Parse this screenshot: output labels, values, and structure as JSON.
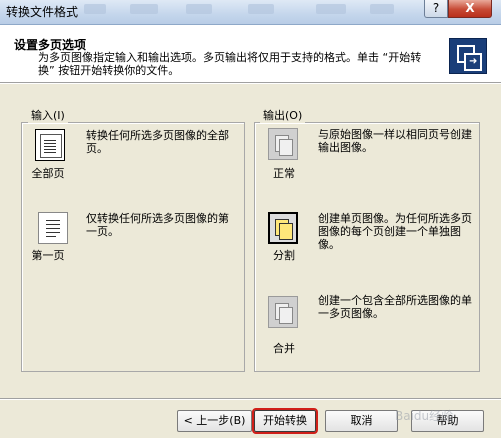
{
  "window": {
    "title": "转换文件格式",
    "help_label": "?",
    "close_label": "X"
  },
  "header": {
    "title": "设置多页选项",
    "description": "为多页图像指定输入和输出选项。多页输出将仅用于支持的格式。单击 “开始转换” 按钮开始转换你的文件。"
  },
  "input_group": {
    "legend": "输入(I)",
    "options": [
      {
        "label": "全部页",
        "desc": "转换任何所选多页图像的全部页。",
        "icon": "all-pages-icon",
        "selected": true
      },
      {
        "label": "第一页",
        "desc": "仅转换任何所选多页图像的第一页。",
        "icon": "first-page-icon",
        "selected": false
      }
    ]
  },
  "output_group": {
    "legend": "输出(O)",
    "options": [
      {
        "label": "正常",
        "desc": "与原始图像一样以相同页号创建输出图像。",
        "icon": "normal-output-icon",
        "selected": false
      },
      {
        "label": "分割",
        "desc": "创建单页图像。为任何所选多页图像的每个页创建一个单独图像。",
        "icon": "split-output-icon",
        "selected": true
      },
      {
        "label": "合并",
        "desc": "创建一个包含全部所选图像的单一多页图像。",
        "icon": "merge-output-icon",
        "selected": false
      }
    ]
  },
  "buttons": {
    "back": "< 上一步(B)",
    "start": "开始转换",
    "cancel": "取消",
    "help": "帮助"
  },
  "watermark": "Baidu经验"
}
